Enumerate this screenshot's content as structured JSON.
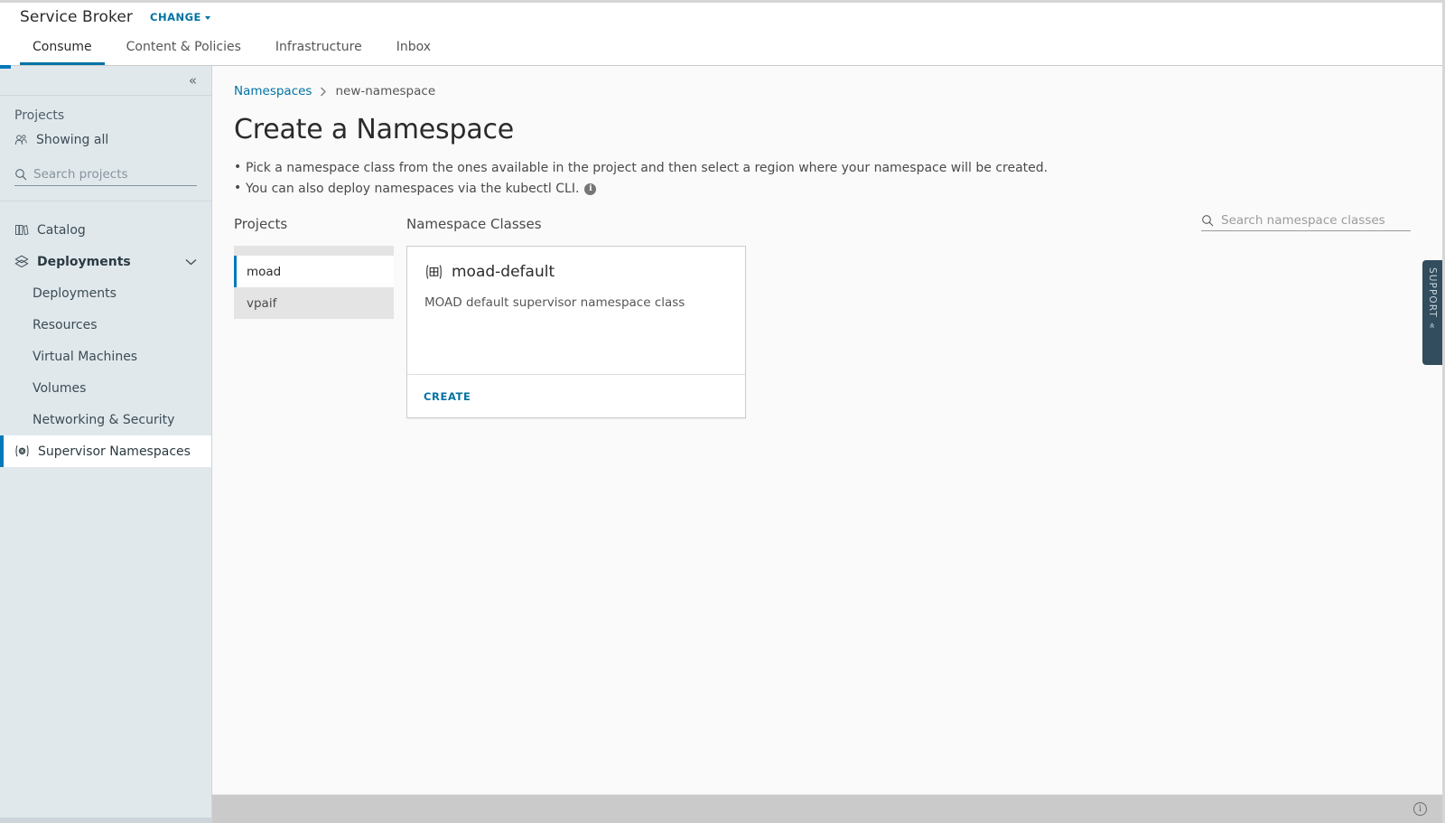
{
  "header": {
    "app_title": "Service Broker",
    "change_label": "CHANGE",
    "chevron_icon": "chevron-down-icon"
  },
  "tabs": [
    {
      "label": "Consume",
      "active": true
    },
    {
      "label": "Content & Policies",
      "active": false
    },
    {
      "label": "Infrastructure",
      "active": false
    },
    {
      "label": "Inbox",
      "active": false
    }
  ],
  "sidebar": {
    "collapse_icon": "«",
    "projects_label": "Projects",
    "showing_all_label": "Showing all",
    "showing_all_icon": "users-group-icon",
    "search_placeholder": "Search projects",
    "search_value": "",
    "search_icon": "search-icon",
    "nav": [
      {
        "label": "Catalog",
        "icon": "books-icon",
        "type": "top",
        "selected": false
      },
      {
        "label": "Deployments",
        "icon": "diamonds-icon",
        "type": "group",
        "selected": false,
        "caret": "chevron-down-icon"
      },
      {
        "label": "Deployments",
        "icon": "",
        "type": "sub",
        "selected": false
      },
      {
        "label": "Resources",
        "icon": "",
        "type": "sub",
        "selected": false
      },
      {
        "label": "Virtual Machines",
        "icon": "",
        "type": "sub",
        "selected": false
      },
      {
        "label": "Volumes",
        "icon": "",
        "type": "sub",
        "selected": false
      },
      {
        "label": "Networking & Security",
        "icon": "",
        "type": "sub",
        "selected": false
      },
      {
        "label": "Supervisor Namespaces",
        "icon": "namespace-icon",
        "type": "top",
        "selected": true
      }
    ]
  },
  "breadcrumb": {
    "root_label": "Namespaces",
    "separator": "›",
    "current_label": "new-namespace"
  },
  "page": {
    "title": "Create a Namespace",
    "hints": [
      "Pick a namespace class from the ones available in the project and then select a region where your namespace will be created.",
      "You can also deploy namespaces via the kubectl CLI."
    ],
    "info_icon": "info-icon",
    "info_glyph": "i"
  },
  "projects_column": {
    "heading": "Projects",
    "items": [
      {
        "label": "moad",
        "selected": true
      },
      {
        "label": "vpaif",
        "selected": false
      }
    ]
  },
  "classes_column": {
    "heading": "Namespace Classes",
    "search_placeholder": "Search namespace classes",
    "search_value": "",
    "search_icon": "search-icon",
    "cards": [
      {
        "icon": "grid-brackets-icon",
        "title": "moad-default",
        "description": "MOAD default supervisor namespace class",
        "action_label": "CREATE"
      }
    ]
  },
  "support": {
    "label": "SUPPORT",
    "chevron": "«"
  },
  "footer": {
    "info_icon": "info-circle-icon",
    "info_glyph": "i"
  },
  "colors": {
    "accent": "#0072a3",
    "accent_bar": "#0079b8",
    "sidebar_bg": "#e1e8ec",
    "support_bg": "#314d5e",
    "footer_bg": "#cacaca"
  }
}
